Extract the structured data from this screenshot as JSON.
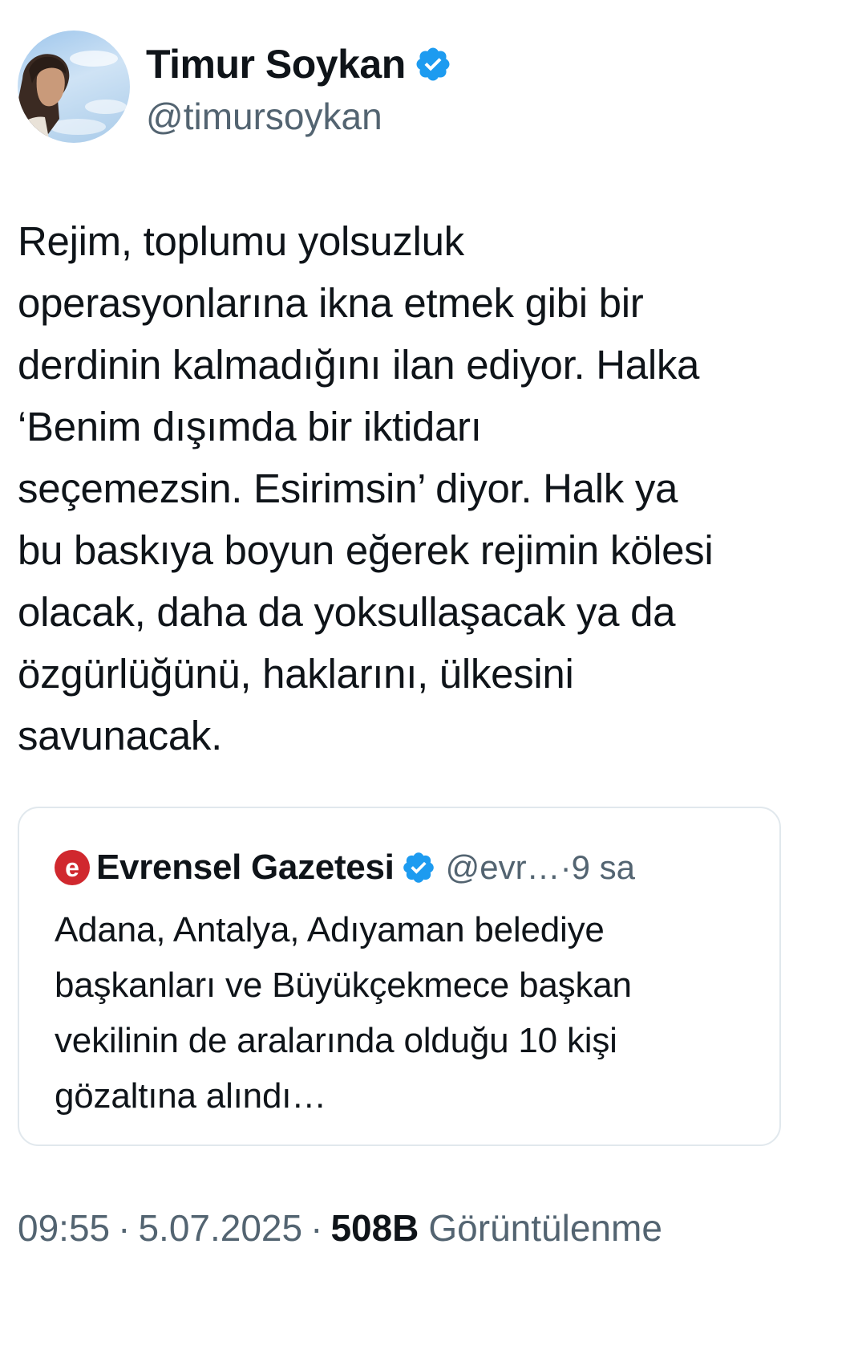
{
  "author": {
    "display_name": "Timur Soykan",
    "handle": "@timursoykan",
    "verified": true
  },
  "tweet": {
    "text": "Rejim, toplumu yolsuzluk\noperasyonlarına ikna etmek gibi bir\nderdinin kalmadığını ilan ediyor. Halka\n‘Benim dışımda bir iktidarı\nseçemezsin. Esirimsin’ diyor. Halk ya\nbu baskıya boyun eğerek rejimin kölesi\nolacak, daha da yoksullaşacak ya da\nözgürlüğünü, haklarını, ülkesini\nsavunacak."
  },
  "quote": {
    "logo_letter": "e",
    "display_name": "Evrensel Gazetesi",
    "handle": "@evr…",
    "time_sep": "·",
    "time": "9 sa",
    "text": "Adana, Antalya, Adıyaman belediye\nbaşkanları ve Büyükçekmece başkan\nvekilinin de aralarında olduğu 10 kişi\ngözaltına alındı…"
  },
  "footer": {
    "time": "09:55",
    "sep1": "·",
    "date": "5.07.2025",
    "sep2": "·",
    "views_count": "508B",
    "views_label": "Görüntülenme"
  },
  "colors": {
    "verified_blue": "#1d9bf0",
    "logo_red": "#d0282e",
    "text_primary": "#0f1419",
    "text_secondary": "#536471",
    "border": "#e1e8ed"
  },
  "icons": {
    "verified": "verified-badge-icon",
    "quote_logo": "evrensel-logo-icon"
  }
}
